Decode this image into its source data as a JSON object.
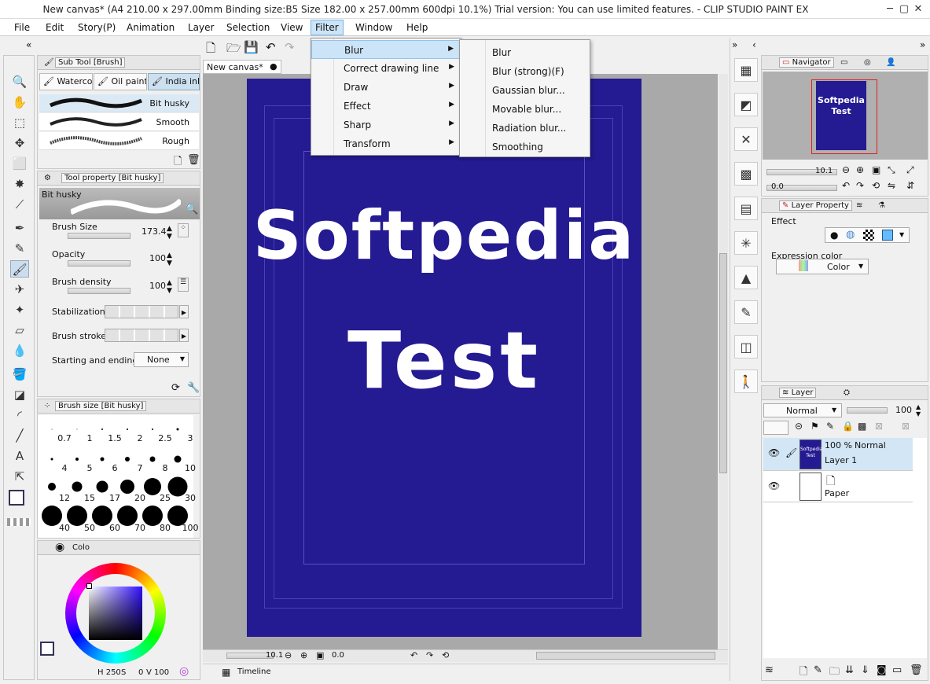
{
  "window": {
    "title": "New canvas* (A4 210.00 x 297.00mm Binding size:B5 Size 182.00 x 257.00mm 600dpi 10.1%)  Trial version: You can use limited features. - CLIP STUDIO PAINT EX"
  },
  "menubar": {
    "items": [
      "File",
      "Edit",
      "Story(P)",
      "Animation",
      "Layer",
      "Selection",
      "View",
      "Filter",
      "Window",
      "Help"
    ]
  },
  "filter_menu": {
    "items": [
      {
        "label": "Blur"
      },
      {
        "label": "Correct drawing line"
      },
      {
        "label": "Draw"
      },
      {
        "label": "Effect"
      },
      {
        "label": "Sharp"
      },
      {
        "label": "Transform"
      }
    ]
  },
  "blur_submenu": {
    "items": [
      "Blur",
      "Blur (strong)(F)",
      "Gaussian blur...",
      "Movable blur...",
      "Radiation blur...",
      "Smoothing"
    ]
  },
  "subtool": {
    "header": "Sub Tool [Brush]",
    "tabs": [
      "Waterco",
      "Oil paint",
      "India ink"
    ],
    "brushes": [
      "Bit husky",
      "Smooth",
      "Rough"
    ]
  },
  "tool_property": {
    "header": "Tool property [Bit husky]",
    "preview_name": "Bit husky",
    "brush_size": {
      "label": "Brush Size",
      "value": "173.4"
    },
    "opacity": {
      "label": "Opacity",
      "value": "100"
    },
    "brush_density": {
      "label": "Brush density",
      "value": "100"
    },
    "stabilization": {
      "label": "Stabilization"
    },
    "brush_stroke": {
      "label": "Brush stroke"
    },
    "start_end": {
      "label": "Starting and ending",
      "value": "None"
    }
  },
  "brush_size_panel": {
    "header": "Brush size [Bit husky]",
    "sizes": [
      "0.7",
      "1",
      "1.5",
      "2",
      "2.5",
      "3",
      "4",
      "5",
      "6",
      "7",
      "8",
      "10",
      "12",
      "15",
      "17",
      "20",
      "25",
      "30",
      "40",
      "50",
      "60",
      "70",
      "80",
      "100"
    ]
  },
  "color_panel": {
    "tab": "Colo",
    "readout": {
      "h": "250",
      "s": "0",
      "v": "100"
    }
  },
  "canvas": {
    "tab": "New canvas*",
    "text_line1": "Softpedia",
    "text_line2": "Test",
    "zoom": "10.1",
    "angle": "0.0",
    "bg_color": "#241a92"
  },
  "timeline": {
    "label": "Timeline"
  },
  "navigator": {
    "tab": "Navigator",
    "zoom": "10.1",
    "angle": "0.0",
    "thumb_text": "Softpedia Test"
  },
  "layer_property": {
    "tab": "Layer Property",
    "effect_label": "Effect",
    "expression_color_label": "Expression color",
    "expression_color_value": "Color"
  },
  "layer_panel": {
    "tab": "Layer",
    "blend_mode": "Normal",
    "opacity": "100",
    "layers": [
      {
        "opacity": "100 %",
        "mode": "Normal",
        "name": "Layer 1"
      },
      {
        "name": "Paper"
      }
    ]
  },
  "colors": {
    "accent": "#cce4f7",
    "canvas": "#241a92",
    "highlight_border": "#e02020"
  }
}
